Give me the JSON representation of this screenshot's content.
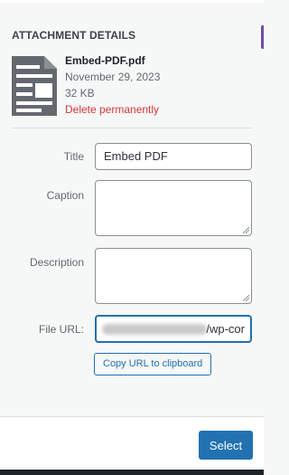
{
  "attachment": {
    "heading": "Attachment Details",
    "file_name": "Embed-PDF.pdf",
    "date": "November 29, 2023",
    "size": "32 KB",
    "delete_label": "Delete permanently",
    "icon": "document-icon"
  },
  "fields": {
    "title_label": "Title",
    "title_value": "Embed PDF",
    "caption_label": "Caption",
    "caption_value": "",
    "description_label": "Description",
    "description_value": "",
    "url_label": "File URL:",
    "url_visible": "/wp-cor",
    "copy_label": "Copy URL to clipboard"
  },
  "footer": {
    "select_label": "Select"
  },
  "colors": {
    "accent": "#2271b1",
    "danger": "#d63638",
    "panel": "#f6f7f7"
  }
}
